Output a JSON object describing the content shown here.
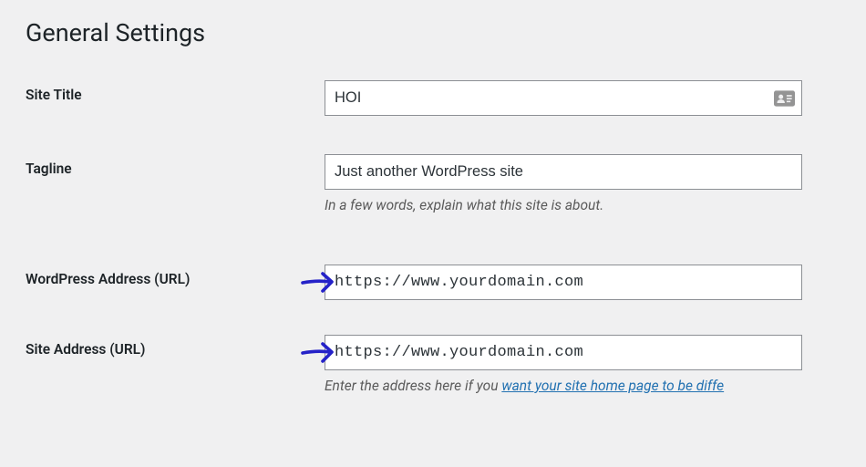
{
  "page_title": "General Settings",
  "fields": {
    "site_title": {
      "label": "Site Title",
      "value": "HOI"
    },
    "tagline": {
      "label": "Tagline",
      "value": "Just another WordPress site",
      "description": "In a few words, explain what this site is about."
    },
    "wp_url": {
      "label": "WordPress Address (URL)",
      "value": "https://www.yourdomain.com"
    },
    "site_url": {
      "label": "Site Address (URL)",
      "value": "https://www.yourdomain.com",
      "description_prefix": "Enter the address here if you ",
      "description_link": "want your site home page to be diffe"
    }
  }
}
